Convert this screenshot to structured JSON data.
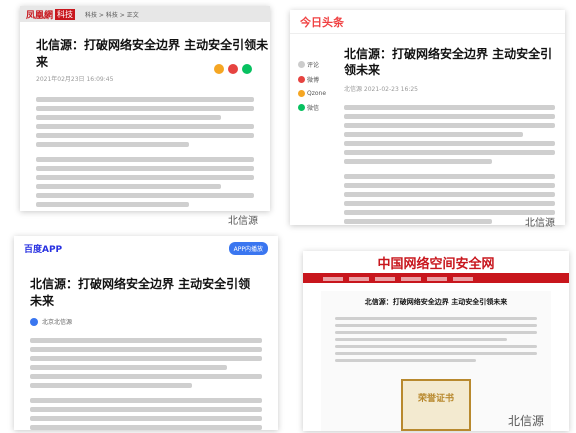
{
  "headline": "北信源：打破网络安全边界 主动安全引领未来",
  "watermark": "北信源",
  "ifeng": {
    "logo": "凤凰網",
    "logo_badge": "科技",
    "crumb": "科技 > 科技 > 正文",
    "meta": "2021年02月23日 16:09:45"
  },
  "toutiao": {
    "logo": "今日头条",
    "side_items": [
      "评论",
      "微博",
      "Qzone",
      "微信"
    ],
    "meta": "北信源 2021-02-23 16:25"
  },
  "baidu": {
    "logo": "百度APP",
    "button": "APP内播放",
    "author": "北京北信源"
  },
  "cert_site": {
    "sitename": "中国网络空间安全网",
    "cert_text": "荣誉证书"
  }
}
